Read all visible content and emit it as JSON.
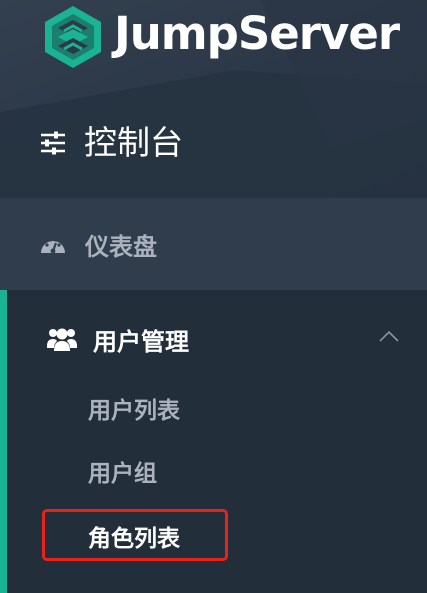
{
  "brand": {
    "name": "JumpServer",
    "logo_icon": "jumpserver-logo-icon"
  },
  "header": {
    "console_label": "控制台",
    "console_icon": "sliders-icon"
  },
  "nav": {
    "dashboard": {
      "label": "仪表盘",
      "icon": "dashboard-gauge-icon"
    },
    "user_management": {
      "label": "用户管理",
      "icon": "users-icon",
      "expanded": true,
      "items": [
        {
          "label": "用户列表",
          "active": false
        },
        {
          "label": "用户组",
          "active": false
        },
        {
          "label": "角色列表",
          "active": true,
          "highlighted": true
        }
      ]
    }
  },
  "colors": {
    "accent": "#1ab394",
    "highlight_border": "#e8231b",
    "sidebar_bg": "#232e3b"
  }
}
